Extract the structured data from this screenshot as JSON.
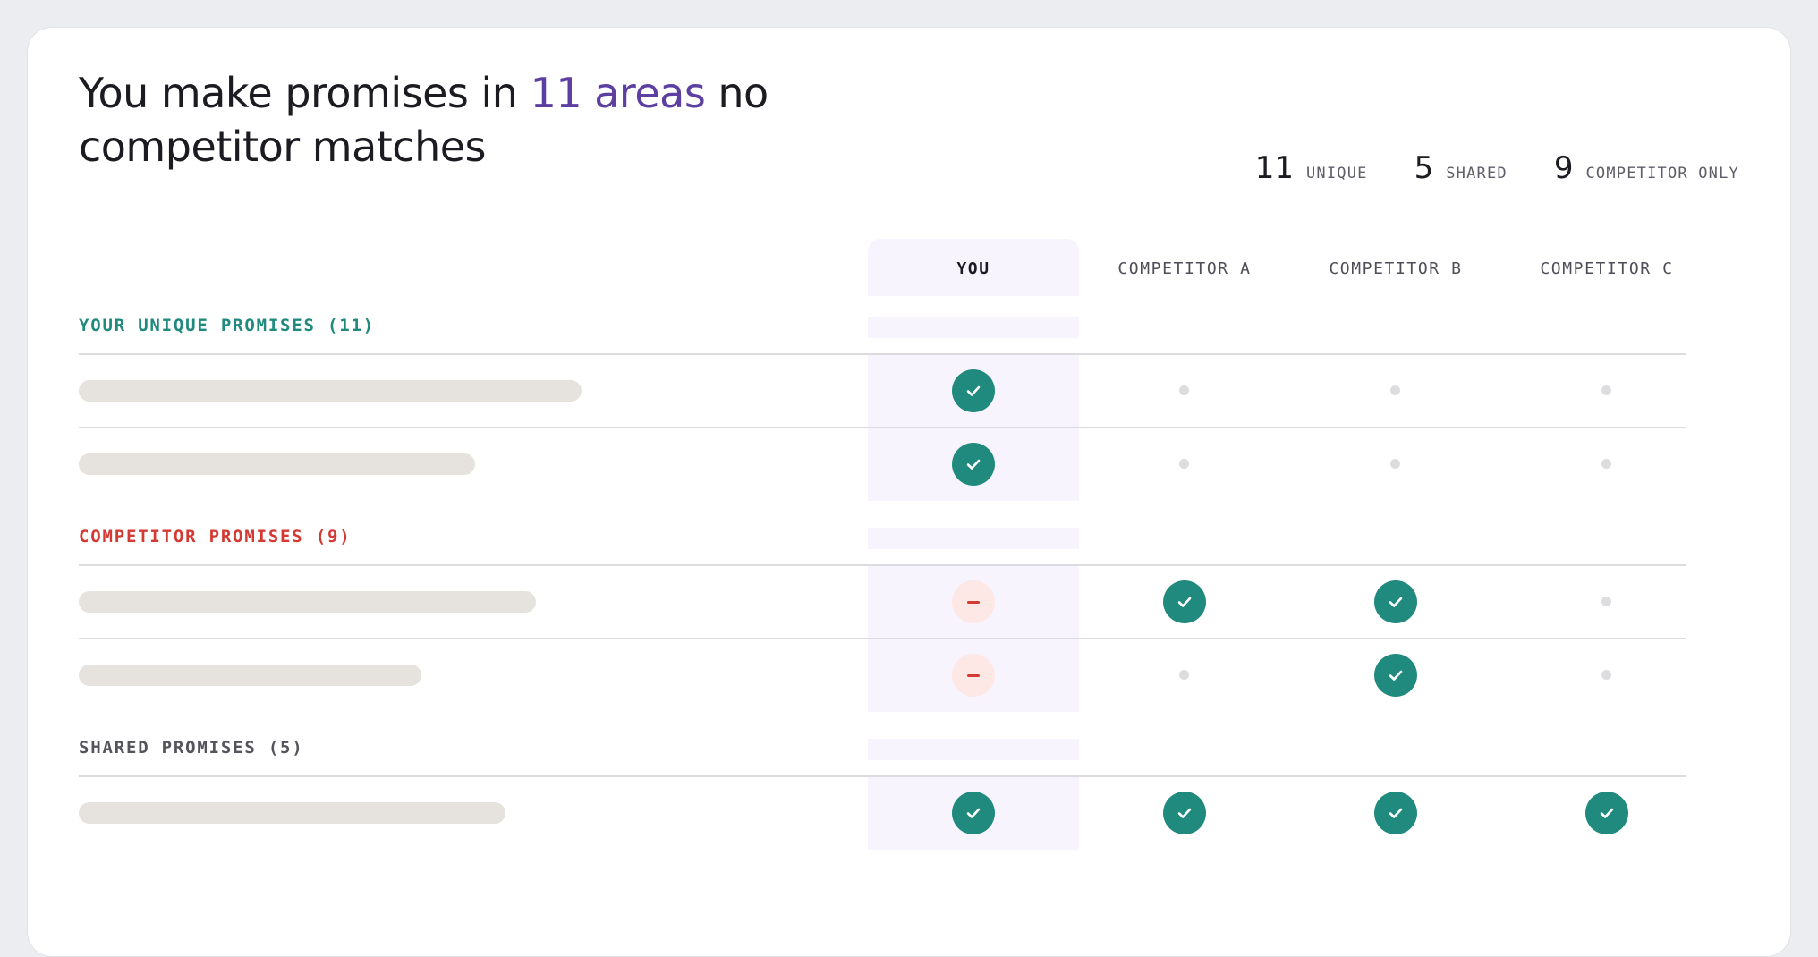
{
  "header": {
    "title_prefix": "You make promises in",
    "title_accent": "11 areas",
    "title_suffix": "no competitor matches",
    "accent_color": "#5c3fa0"
  },
  "stats": [
    {
      "value": "11",
      "label": "UNIQUE"
    },
    {
      "value": "5",
      "label": "SHARED"
    },
    {
      "value": "9",
      "label": "COMPETITOR ONLY"
    }
  ],
  "columns": [
    "YOU",
    "COMPETITOR A",
    "COMPETITOR B",
    "COMPETITOR C"
  ],
  "sections": [
    {
      "label": "YOUR UNIQUE PROMISES (11)",
      "tone": "teal",
      "rows": [
        [
          "check",
          "none",
          "none",
          "none"
        ],
        [
          "check",
          "none",
          "none",
          "none"
        ]
      ]
    },
    {
      "label": "COMPETITOR PROMISES (9)",
      "tone": "red",
      "rows": [
        [
          "missing",
          "check",
          "check",
          "none"
        ],
        [
          "missing",
          "none",
          "check",
          "none"
        ]
      ]
    },
    {
      "label": "SHARED PROMISES (5)",
      "tone": "gray",
      "rows": [
        [
          "check",
          "check",
          "check",
          "check"
        ]
      ]
    }
  ],
  "icons": {
    "check": "check-icon",
    "missing": "minus-icon",
    "none": "empty-dot-icon"
  },
  "colors": {
    "check": "#1f8a7d",
    "missing": "#d43a34",
    "placeholder": "#e6e2dd"
  }
}
